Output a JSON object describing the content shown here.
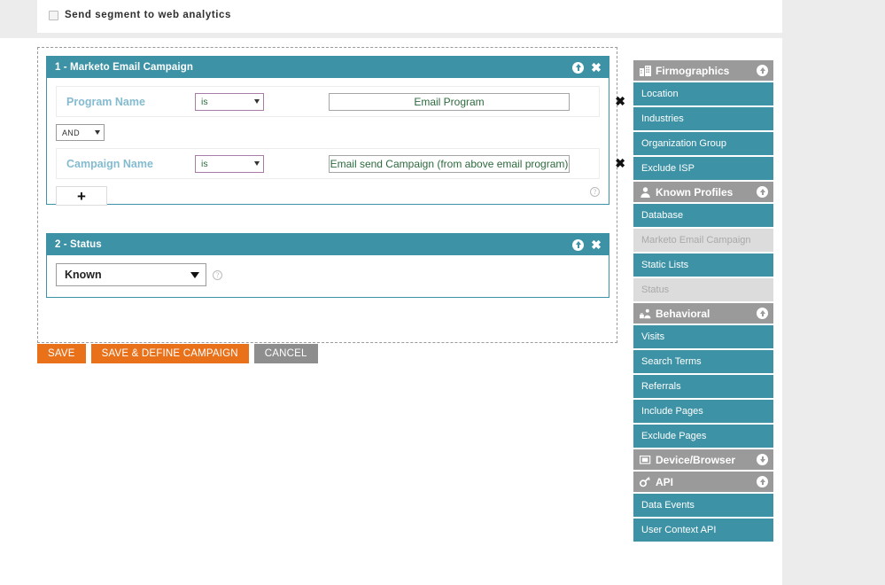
{
  "top": {
    "checkbox_label": "Send segment to web analytics",
    "checked": false
  },
  "builder": {
    "groups": [
      {
        "title": "1 - Marketo Email Campaign",
        "rules": [
          {
            "field": "Program Name",
            "operator": "is",
            "value": "Email Program",
            "remove_label": "✖"
          },
          {
            "field": "Campaign Name",
            "operator": "is",
            "value": "Email send Campaign (from above email program)",
            "remove_label": "✖"
          }
        ],
        "joiner": "AND",
        "add_label": "+",
        "help_label": "?"
      },
      {
        "title": "2 - Status",
        "status_value": "Known",
        "help_label": "?"
      }
    ]
  },
  "actions": {
    "save": "SAVE",
    "save_define": "SAVE & DEFINE CAMPAIGN",
    "cancel": "CANCEL"
  },
  "sidebar": {
    "sections": [
      {
        "title": "Firmographics",
        "icon": "building-icon",
        "arrow": "up",
        "items": [
          {
            "label": "Location",
            "disabled": false
          },
          {
            "label": "Industries",
            "disabled": false
          },
          {
            "label": "Organization Group",
            "disabled": false
          },
          {
            "label": "Exclude ISP",
            "disabled": false
          }
        ]
      },
      {
        "title": "Known Profiles",
        "icon": "person-icon",
        "arrow": "up",
        "items": [
          {
            "label": "Database",
            "disabled": false
          },
          {
            "label": "Marketo Email Campaign",
            "disabled": true
          },
          {
            "label": "Static Lists",
            "disabled": false
          },
          {
            "label": "Status",
            "disabled": true
          }
        ]
      },
      {
        "title": "Behavioral",
        "icon": "behavioral-icon",
        "arrow": "up",
        "items": [
          {
            "label": "Visits",
            "disabled": false
          },
          {
            "label": "Search Terms",
            "disabled": false
          },
          {
            "label": "Referrals",
            "disabled": false
          },
          {
            "label": "Include Pages",
            "disabled": false
          },
          {
            "label": "Exclude Pages",
            "disabled": false
          }
        ]
      },
      {
        "title": "Device/Browser",
        "icon": "monitor-icon",
        "arrow": "down",
        "items": []
      },
      {
        "title": "API",
        "icon": "gear-icon",
        "arrow": "up",
        "items": [
          {
            "label": "Data Events",
            "disabled": false
          },
          {
            "label": "User Context API",
            "disabled": false
          }
        ]
      }
    ]
  },
  "colors": {
    "teal": "#3d92a5",
    "gray_header": "#9a9a9a",
    "orange": "#e8711a",
    "cancel_gray": "#8e8e8e",
    "field_label": "#84bbd0",
    "value_text": "#2d6a3e",
    "page_bg": "#ececec"
  }
}
